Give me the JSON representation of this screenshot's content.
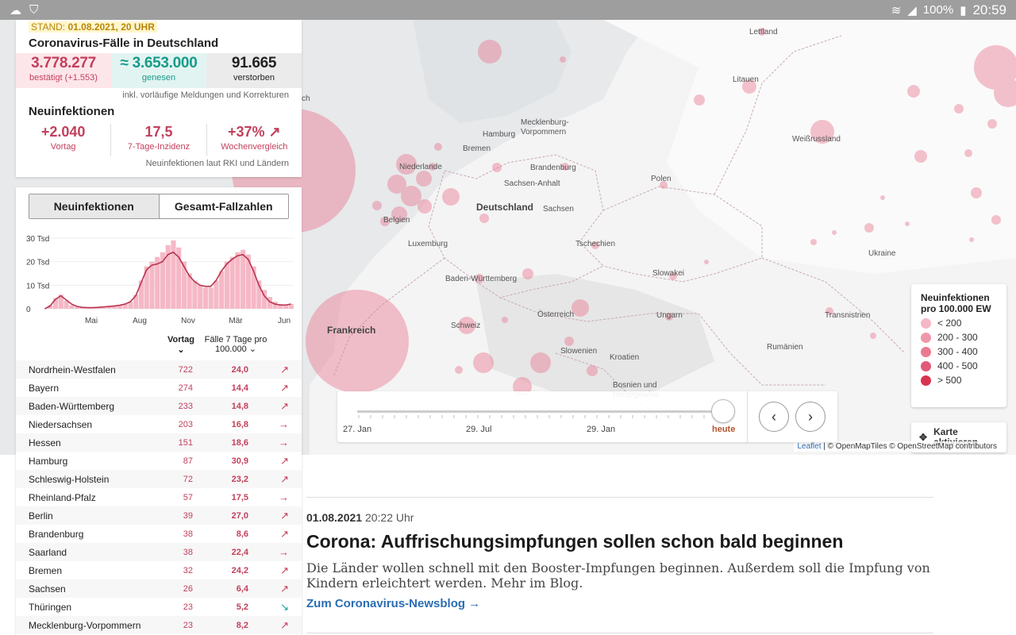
{
  "status_bar": {
    "battery": "100%",
    "time": "20:59"
  },
  "summary": {
    "stand_label": "STAND:",
    "stand_value": "01.08.2021, 20 UHR",
    "title": "Coronavirus-Fälle in Deutschland",
    "confirmed": "3.778.277",
    "confirmed_label": "bestätigt (+1.553)",
    "recovered": "≈ 3.653.000",
    "recovered_label": "genesen",
    "deaths": "91.665",
    "deaths_label": "verstorben",
    "note1": "inkl. vorläufige Meldungen und Korrekturen",
    "new_title": "Neuinfektionen",
    "new_prev_day": "+2.040",
    "new_prev_day_label": "Vortag",
    "incidence": "17,5",
    "incidence_label": "7-Tage-Inzidenz",
    "week_compare": "+37% ↗",
    "week_compare_label": "Wochenvergleich",
    "note2": "Neuinfektionen laut RKI und Ländern"
  },
  "tabs": [
    "Neuinfektionen",
    "Gesamt-Fallzahlen"
  ],
  "chart_data": {
    "type": "bar",
    "title": "",
    "y_ticks": [
      "30 Tsd",
      "20 Tsd",
      "10 Tsd",
      "0"
    ],
    "x_ticks": [
      "Mai",
      "Aug",
      "Nov",
      "Mär",
      "Jun"
    ],
    "ylim": [
      0,
      32000
    ],
    "series": [
      {
        "values": [
          0,
          1500,
          4500,
          6000,
          3500,
          1500,
          800,
          500,
          400,
          500,
          600,
          800,
          1000,
          1200,
          1500,
          2000,
          3000,
          6000,
          12000,
          18000,
          20000,
          22000,
          24000,
          27000,
          29000,
          26000,
          20000,
          15000,
          12000,
          10000,
          9000,
          9000,
          12000,
          16000,
          20000,
          22000,
          24000,
          25000,
          23000,
          18000,
          12000,
          8000,
          5000,
          3000,
          2000,
          1500,
          2000
        ]
      },
      {
        "values": [
          0,
          1200,
          4000,
          5500,
          3800,
          2000,
          1000,
          600,
          500,
          500,
          600,
          800,
          1000,
          1200,
          1500,
          2000,
          3000,
          5500,
          11000,
          16500,
          18500,
          19000,
          20000,
          23000,
          24000,
          22000,
          18000,
          14000,
          11500,
          10000,
          9500,
          9500,
          12000,
          16000,
          19000,
          21000,
          22500,
          23000,
          21000,
          16000,
          10000,
          5500,
          3000,
          2000,
          1600,
          1600,
          2000
        ]
      }
    ]
  },
  "table": {
    "col_vortag": "Vortag",
    "col_faelle": "Fälle 7 Tage pro 100.000",
    "rows": [
      {
        "name": "Nordrhein-Westfalen",
        "vortag": "722",
        "inc": "24,0",
        "trend": "↗"
      },
      {
        "name": "Bayern",
        "vortag": "274",
        "inc": "14,4",
        "trend": "↗"
      },
      {
        "name": "Baden-Württemberg",
        "vortag": "233",
        "inc": "14,8",
        "trend": "↗"
      },
      {
        "name": "Niedersachsen",
        "vortag": "203",
        "inc": "16,8",
        "trend": "→"
      },
      {
        "name": "Hessen",
        "vortag": "151",
        "inc": "18,6",
        "trend": "→"
      },
      {
        "name": "Hamburg",
        "vortag": "87",
        "inc": "30,9",
        "trend": "↗"
      },
      {
        "name": "Schleswig-Holstein",
        "vortag": "72",
        "inc": "23,2",
        "trend": "↗"
      },
      {
        "name": "Rheinland-Pfalz",
        "vortag": "57",
        "inc": "17,5",
        "trend": "→"
      },
      {
        "name": "Berlin",
        "vortag": "39",
        "inc": "27,0",
        "trend": "↗"
      },
      {
        "name": "Brandenburg",
        "vortag": "38",
        "inc": "8,6",
        "trend": "↗"
      },
      {
        "name": "Saarland",
        "vortag": "38",
        "inc": "22,4",
        "trend": "→"
      },
      {
        "name": "Bremen",
        "vortag": "32",
        "inc": "24,2",
        "trend": "↗"
      },
      {
        "name": "Sachsen",
        "vortag": "26",
        "inc": "6,4",
        "trend": "↗"
      },
      {
        "name": "Thüringen",
        "vortag": "23",
        "inc": "5,2",
        "trend": "↘"
      },
      {
        "name": "Mecklenburg-Vorpommern",
        "vortag": "23",
        "inc": "8,2",
        "trend": "↗"
      }
    ]
  },
  "map": {
    "labels": [
      {
        "text": "Lettland",
        "cls": "country"
      },
      {
        "text": "Litauen",
        "cls": "country"
      },
      {
        "text": "Weißrussland",
        "cls": "country"
      },
      {
        "text": "Mecklenburg-\nVorpommern",
        "cls": ""
      },
      {
        "text": "Hamburg",
        "cls": ""
      },
      {
        "text": "Bremen",
        "cls": ""
      },
      {
        "text": "Niederlande",
        "cls": "country"
      },
      {
        "text": "Brandenburg",
        "cls": ""
      },
      {
        "text": "Polen",
        "cls": "country"
      },
      {
        "text": "Sachsen-Anhalt",
        "cls": ""
      },
      {
        "text": "Deutschland",
        "cls": "big"
      },
      {
        "text": "Sachsen",
        "cls": ""
      },
      {
        "text": "Belgien",
        "cls": "country"
      },
      {
        "text": "Luxemburg",
        "cls": "country"
      },
      {
        "text": "Tschechien",
        "cls": "country"
      },
      {
        "text": "Ukraine",
        "cls": "country"
      },
      {
        "text": "Slowakei",
        "cls": "country"
      },
      {
        "text": "Baden-Württemberg",
        "cls": ""
      },
      {
        "text": "Frankreich",
        "cls": "big"
      },
      {
        "text": "Österreich",
        "cls": "country"
      },
      {
        "text": "Ungarn",
        "cls": "country"
      },
      {
        "text": "Transnistrien",
        "cls": "country"
      },
      {
        "text": "Schweiz",
        "cls": "country"
      },
      {
        "text": "Slowenien",
        "cls": "country"
      },
      {
        "text": "Rumänien",
        "cls": "country"
      },
      {
        "text": "Kroatien",
        "cls": "country"
      },
      {
        "text": "Bosnien und\nHerzegowina",
        "cls": "country"
      },
      {
        "text": "ch",
        "cls": "country"
      }
    ],
    "attribution_leaflet": "Leaflet",
    "attribution_rest": "| © OpenMapTiles © OpenStreetMap contributors"
  },
  "legend": {
    "title": "Neuinfektionen pro 100.000 EW",
    "items": [
      {
        "label": "< 200",
        "color": "#f5b8c6"
      },
      {
        "label": "200 - 300",
        "color": "#ef98ab"
      },
      {
        "label": "300 - 400",
        "color": "#e97a92"
      },
      {
        "label": "400 - 500",
        "color": "#e25a78"
      },
      {
        "label": "> 500",
        "color": "#d8334f"
      }
    ]
  },
  "activate_label": "Karte aktivieren",
  "timeline": {
    "labels": [
      "27. Jan",
      "29. Jul",
      "29. Jan"
    ],
    "today": "heute",
    "position": 1.0
  },
  "article": {
    "date": "01.08.2021",
    "time": "20:22 Uhr",
    "title": "Corona: Auffrischungsimpfungen sollen schon bald beginnen",
    "text": "Die Länder wollen schnell mit den Booster-Impfungen beginnen. Außerdem soll die Impfung von Kindern erleichtert werden. Mehr im Blog.",
    "link": "Zum Coronavirus-Newsblog →"
  }
}
